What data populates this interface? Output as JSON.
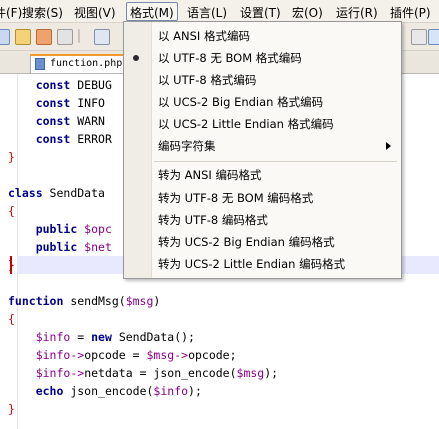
{
  "menubar": {
    "items": [
      {
        "label": "件(F)"
      },
      {
        "label": "搜索(S)"
      },
      {
        "label": "视图(V)"
      },
      {
        "label": "格式(M)"
      },
      {
        "label": "语言(L)"
      },
      {
        "label": "设置(T)"
      },
      {
        "label": "宏(O)"
      },
      {
        "label": "运行(R)"
      },
      {
        "label": "插件(P)"
      }
    ]
  },
  "tab": {
    "label": "function.php"
  },
  "code": [
    {
      "indent": "    ",
      "kw": "const",
      "rest": " DEBUG"
    },
    {
      "indent": "    ",
      "kw": "const",
      "rest": " INFO"
    },
    {
      "indent": "    ",
      "kw": "const",
      "rest": " WARN"
    },
    {
      "indent": "    ",
      "kw": "const",
      "rest": " ERROR"
    },
    {
      "text": "}"
    },
    {
      "text": ""
    },
    {
      "kw": "class",
      "rest": " SendData"
    },
    {
      "text": "{"
    },
    {
      "indent": "    ",
      "kw": "public",
      "var": " $opc"
    },
    {
      "indent": "    ",
      "kw": "public",
      "var": " $net"
    },
    {
      "text": "}"
    },
    {
      "text": ""
    },
    {
      "kw": "function",
      "rest": " sendMsg(",
      "var": "$msg",
      "tail": ")"
    },
    {
      "text": "{"
    },
    {
      "text": ""
    },
    {
      "indent": "    ",
      "var": "$info",
      "tail": " = ",
      "kw": "new",
      "rest": " SendData();"
    },
    {
      "indent": "    ",
      "var": "$info",
      "op": "->",
      "rest": "opcode = ",
      "var2": "$msg",
      "op2": "->",
      "rest2": "opcode;"
    },
    {
      "indent": "    ",
      "var": "$info",
      "op": "->",
      "rest": "netdata = json_encode(",
      "var2": "$msg",
      "rest2": ");"
    },
    {
      "indent": "    ",
      "kw": "echo",
      "rest": " json_encode(",
      "var2": "$info",
      "rest2": ");"
    },
    {
      "text": "}"
    }
  ],
  "dropdown": {
    "items": [
      {
        "label": "以 ANSI 格式编码"
      },
      {
        "label": "以 UTF-8 无 BOM 格式编码",
        "checked": true
      },
      {
        "label": "以 UTF-8 格式编码"
      },
      {
        "label": "以 UCS-2 Big Endian 格式编码"
      },
      {
        "label": "以 UCS-2 Little Endian 格式编码"
      },
      {
        "label": "编码字符集",
        "submenu": true
      },
      {
        "label": "转为 ANSI 编码格式"
      },
      {
        "label": "转为 UTF-8 无 BOM 编码格式"
      },
      {
        "label": "转为 UTF-8 编码格式"
      },
      {
        "label": "转为 UCS-2 Big Endian 编码格式"
      },
      {
        "label": "转为 UCS-2 Little Endian 编码格式"
      }
    ]
  }
}
